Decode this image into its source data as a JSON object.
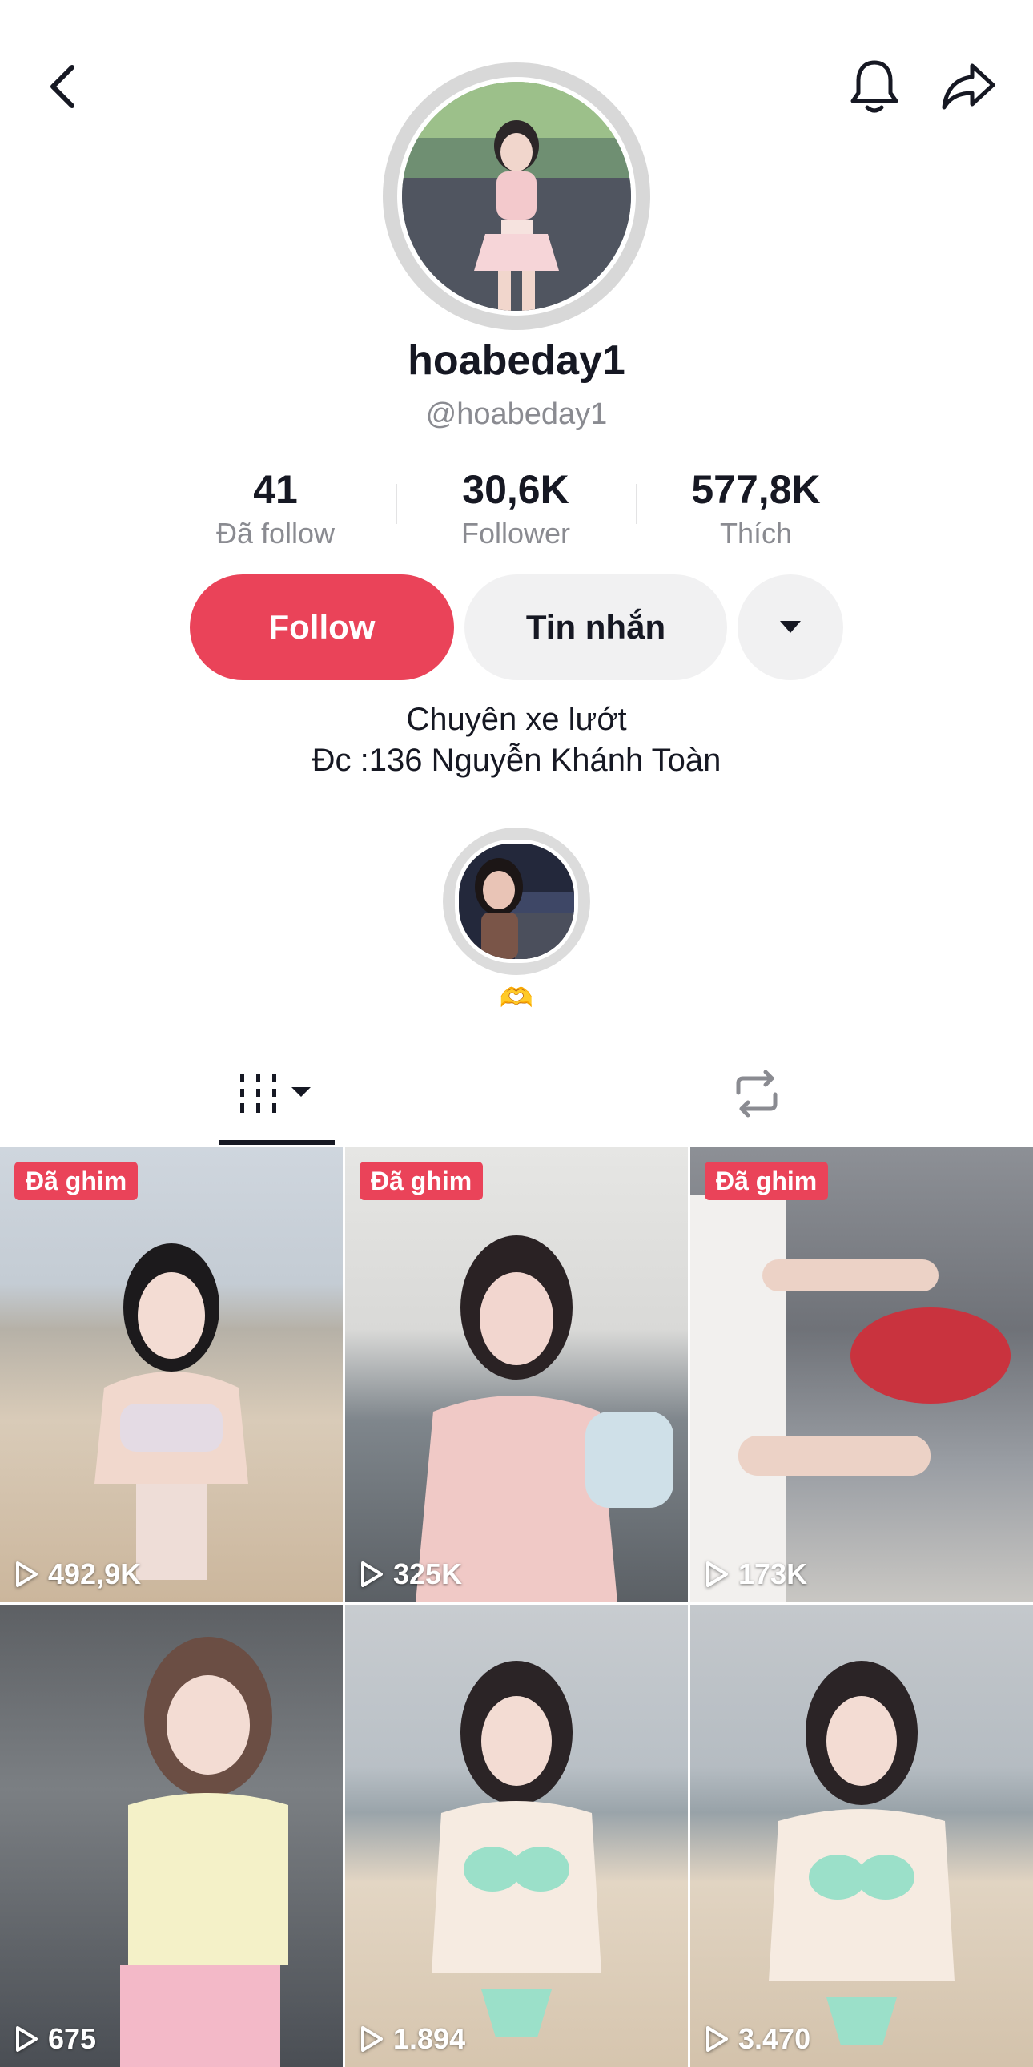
{
  "header": {
    "back_icon": "chevron-left-icon",
    "notification_icon": "bell-icon",
    "share_icon": "share-arrow-icon"
  },
  "profile": {
    "display_name": "hoabeday1",
    "handle": "@hoabeday1"
  },
  "stats": [
    {
      "value": "41",
      "label": "Đã follow"
    },
    {
      "value": "30,6K",
      "label": "Follower"
    },
    {
      "value": "577,8K",
      "label": "Thích"
    }
  ],
  "actions": {
    "follow_label": "Follow",
    "message_label": "Tin nhắn",
    "more_icon": "caret-down-icon"
  },
  "bio": {
    "line1": "Chuyên xe lướt",
    "line2": "Đc :136 Nguyễn Khánh Toàn"
  },
  "highlight": {
    "caption": "🫶"
  },
  "tabs": {
    "videos_icon": "videos-grid-icon",
    "reposts_icon": "repost-icon"
  },
  "videos": [
    {
      "pinned_label": "Đã ghim",
      "views": "492,9K"
    },
    {
      "pinned_label": "Đã ghim",
      "views": "325K"
    },
    {
      "pinned_label": "Đã ghim",
      "views": "173K"
    },
    {
      "pinned_label": "",
      "views": "675"
    },
    {
      "pinned_label": "",
      "views": "1.894"
    },
    {
      "pinned_label": "",
      "views": "3.470"
    }
  ],
  "colors": {
    "accent": "#ea4359",
    "secondary_button": "#f1f1f2",
    "muted_text": "#8a8b91"
  }
}
